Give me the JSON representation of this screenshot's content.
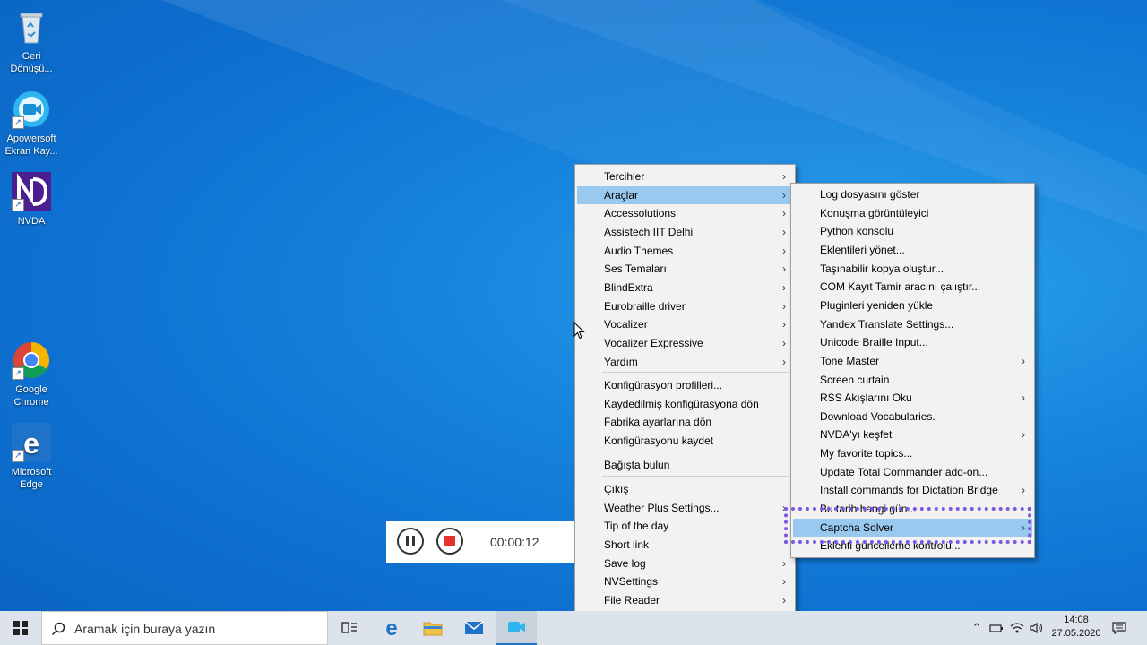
{
  "desktop": {
    "icons": [
      {
        "label": "Geri Dönüşü...",
        "icon": "recycle-bin-icon"
      },
      {
        "label": "Apowersoft Ekran Kay...",
        "icon": "apowersoft-icon"
      },
      {
        "label": "NVDA",
        "icon": "nvda-icon"
      },
      {
        "label": "Google Chrome",
        "icon": "chrome-icon"
      },
      {
        "label": "Microsoft Edge",
        "icon": "edge-icon"
      }
    ]
  },
  "recorder": {
    "time": "00:00:12",
    "pause_icon": "pause-icon",
    "stop_icon": "stop-icon"
  },
  "main_menu": {
    "items": [
      {
        "label": "Tercihler",
        "submenu": true
      },
      {
        "label": "Araçlar",
        "submenu": true,
        "selected": true
      },
      {
        "label": "Accessolutions",
        "submenu": true
      },
      {
        "label": "Assistech IIT Delhi",
        "submenu": true
      },
      {
        "label": "Audio Themes",
        "submenu": true
      },
      {
        "label": "Ses Temaları",
        "submenu": true
      },
      {
        "label": "BlindExtra",
        "submenu": true
      },
      {
        "label": "Eurobraille driver",
        "submenu": true
      },
      {
        "label": "Vocalizer",
        "submenu": true
      },
      {
        "label": "Vocalizer Expressive",
        "submenu": true
      },
      {
        "label": "Yardım",
        "submenu": true
      },
      {
        "label": "Konfigürasyon profilleri...",
        "submenu": false
      },
      {
        "label": "Kaydedilmiş konfigürasyona dön",
        "submenu": false
      },
      {
        "label": "Fabrika ayarlarına dön",
        "submenu": false
      },
      {
        "label": "Konfigürasyonu kaydet",
        "submenu": false
      },
      {
        "label": "Bağışta bulun",
        "submenu": false
      },
      {
        "label": "Çıkış",
        "submenu": false
      },
      {
        "label": "Weather Plus Settings...",
        "submenu": true
      },
      {
        "label": "Tip of the day",
        "submenu": false
      },
      {
        "label": "Short link",
        "submenu": false
      },
      {
        "label": "Save log",
        "submenu": true
      },
      {
        "label": "NVSettings",
        "submenu": true
      },
      {
        "label": "File Reader",
        "submenu": true
      }
    ]
  },
  "tools_menu": {
    "items": [
      {
        "label": "Log dosyasını göster",
        "submenu": false
      },
      {
        "label": "Konuşma görüntüleyici",
        "submenu": false
      },
      {
        "label": "Python konsolu",
        "submenu": false
      },
      {
        "label": "Eklentileri yönet...",
        "submenu": false
      },
      {
        "label": "Taşınabilir kopya oluştur...",
        "submenu": false
      },
      {
        "label": "COM Kayıt Tamir aracını  çalıştır...",
        "submenu": false
      },
      {
        "label": "Pluginleri yeniden yükle",
        "submenu": false
      },
      {
        "label": "Yandex Translate Settings...",
        "submenu": false
      },
      {
        "label": "Unicode Braille Input...",
        "submenu": false
      },
      {
        "label": "Tone Master",
        "submenu": true
      },
      {
        "label": "Screen curtain",
        "submenu": false
      },
      {
        "label": "RSS Akışlarını Oku",
        "submenu": true
      },
      {
        "label": "Download Vocabularies.",
        "submenu": false
      },
      {
        "label": "NVDA'yı keşfet",
        "submenu": true
      },
      {
        "label": "My favorite topics...",
        "submenu": false
      },
      {
        "label": "Update Total Commander add-on...",
        "submenu": false
      },
      {
        "label": "Install commands for Dictation Bridge",
        "submenu": true
      },
      {
        "label": "Bu tarih hangi gün...",
        "submenu": false
      },
      {
        "label": "Captcha Solver",
        "submenu": true,
        "selected": true
      },
      {
        "label": "Eklenti güncelleme kontrolü...",
        "submenu": false
      }
    ]
  },
  "taskbar": {
    "search_placeholder": "Aramak için buraya yazın",
    "clock_time": "14:08",
    "clock_date": "27.05.2020"
  }
}
